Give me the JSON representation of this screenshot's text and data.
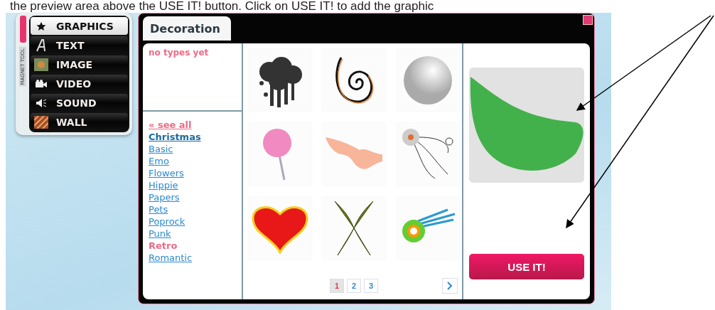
{
  "caption": "the preview area above the USE IT! button. Click on USE IT! to add the graphic",
  "tool_menu": {
    "label": "MAGNET TOOL",
    "items": [
      {
        "label": "GRAPHICS",
        "kind": "star",
        "selected": true
      },
      {
        "label": "TEXT",
        "kind": "letter",
        "selected": false
      },
      {
        "label": "IMAGE",
        "kind": "photo",
        "selected": false
      },
      {
        "label": "VIDEO",
        "kind": "camera",
        "selected": false
      },
      {
        "label": "SOUND",
        "kind": "speaker",
        "selected": false
      },
      {
        "label": "WALL",
        "kind": "pattern",
        "selected": false
      }
    ]
  },
  "dialog": {
    "tab": "Decoration",
    "types_note": "no types yet",
    "categories": [
      {
        "label": "« see all",
        "kind": "back",
        "selected": false,
        "hovered": false
      },
      {
        "label": "Christmas",
        "kind": "category",
        "selected": true,
        "hovered": false
      },
      {
        "label": "Basic",
        "kind": "category",
        "selected": false,
        "hovered": false
      },
      {
        "label": "Emo",
        "kind": "category",
        "selected": false,
        "hovered": false
      },
      {
        "label": "Flowers",
        "kind": "category",
        "selected": false,
        "hovered": false
      },
      {
        "label": "Hippie",
        "kind": "category",
        "selected": false,
        "hovered": false
      },
      {
        "label": "Papers",
        "kind": "category",
        "selected": false,
        "hovered": false
      },
      {
        "label": "Pets",
        "kind": "category",
        "selected": false,
        "hovered": false
      },
      {
        "label": "Poprock",
        "kind": "category",
        "selected": false,
        "hovered": false
      },
      {
        "label": "Punk",
        "kind": "category",
        "selected": false,
        "hovered": false
      },
      {
        "label": "Retro",
        "kind": "category",
        "selected": false,
        "hovered": true
      },
      {
        "label": "Romantic",
        "kind": "category",
        "selected": false,
        "hovered": false
      }
    ],
    "thumbnails": [
      {
        "kind": "splatter"
      },
      {
        "kind": "spiral"
      },
      {
        "kind": "sphere"
      },
      {
        "kind": "lollipop"
      },
      {
        "kind": "wing"
      },
      {
        "kind": "flower-swirl"
      },
      {
        "kind": "heart"
      },
      {
        "kind": "wings"
      },
      {
        "kind": "flower-burst"
      }
    ],
    "pages": [
      {
        "label": "1",
        "selected": true
      },
      {
        "label": "2",
        "selected": false
      },
      {
        "label": "3",
        "selected": false
      }
    ],
    "use_button": "USE IT!"
  }
}
